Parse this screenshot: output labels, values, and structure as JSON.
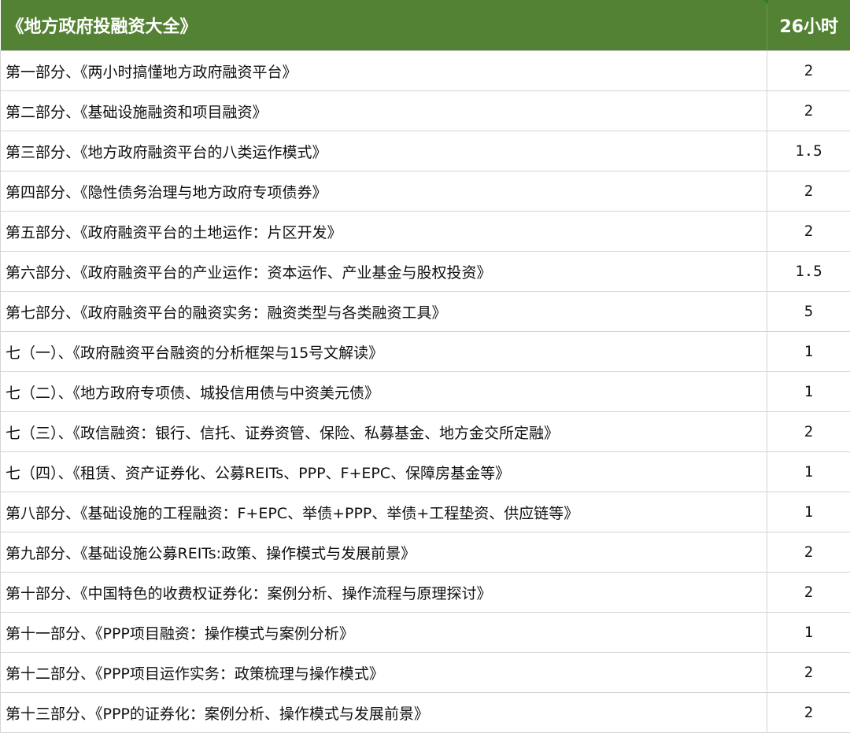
{
  "header": {
    "title": "《地方政府投融资大全》",
    "total_hours": "26小时"
  },
  "rows": [
    {
      "title": "第一部分、《两小时搞懂地方政府融资平台》",
      "hours": "2"
    },
    {
      "title": "第二部分、《基础设施融资和项目融资》",
      "hours": "2"
    },
    {
      "title": "第三部分、《地方政府融资平台的八类运作模式》",
      "hours": "1.5"
    },
    {
      "title": "第四部分、《隐性债务治理与地方政府专项债券》",
      "hours": "2"
    },
    {
      "title": "第五部分、《政府融资平台的土地运作：片区开发》",
      "hours": "2"
    },
    {
      "title": "第六部分、《政府融资平台的产业运作：资本运作、产业基金与股权投资》",
      "hours": "1.5"
    },
    {
      "title": "第七部分、《政府融资平台的融资实务：融资类型与各类融资工具》",
      "hours": "5"
    },
    {
      "title": "七（一）、《政府融资平台融资的分析框架与15号文解读》",
      "hours": "1"
    },
    {
      "title": "七（二）、《地方政府专项债、城投信用债与中资美元债》",
      "hours": "1"
    },
    {
      "title": "七（三）、《政信融资：银行、信托、证券资管、保险、私募基金、地方金交所定融》",
      "hours": "2"
    },
    {
      "title": "七（四）、《租赁、资产证券化、公募REITs、PPP、F+EPC、保障房基金等》",
      "hours": "1"
    },
    {
      "title": "第八部分、《基础设施的工程融资：F+EPC、举债+PPP、举债+工程垫资、供应链等》",
      "hours": "1"
    },
    {
      "title": "第九部分、《基础设施公募REITs:政策、操作模式与发展前景》",
      "hours": "2"
    },
    {
      "title": "第十部分、《中国特色的收费权证券化：案例分析、操作流程与原理探讨》",
      "hours": "2"
    },
    {
      "title": "第十一部分、《PPP项目融资：操作模式与案例分析》",
      "hours": "1"
    },
    {
      "title": "第十二部分、《PPP项目运作实务：政策梳理与操作模式》",
      "hours": "2"
    },
    {
      "title": "第十三部分、《PPP的证券化：案例分析、操作模式与发展前景》",
      "hours": "2"
    }
  ],
  "colors": {
    "header_bg": "#548235",
    "header_text": "#ffffff",
    "grid": "#d4d4d4"
  }
}
